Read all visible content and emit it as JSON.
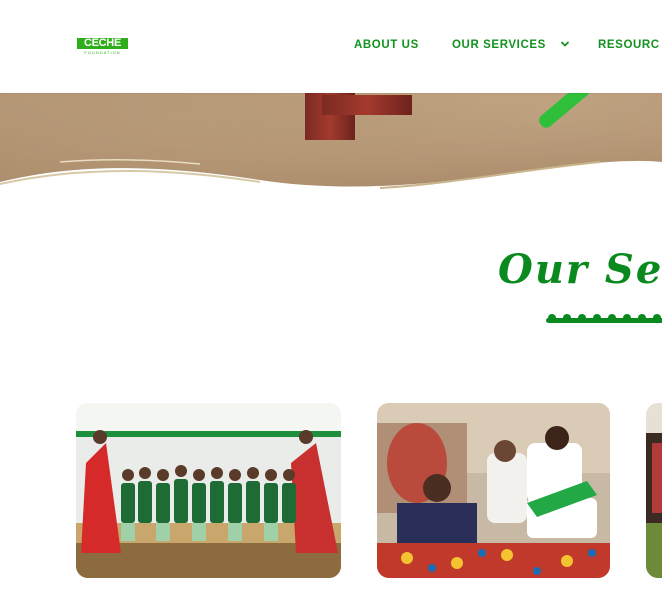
{
  "logo": {
    "name": "CECHE",
    "tagline": "FOUNDATION"
  },
  "nav": {
    "items": [
      {
        "label": "ABOUT US"
      },
      {
        "label": "OUR SERVICES"
      },
      {
        "label": "RESOURC"
      }
    ]
  },
  "section": {
    "title": "Our Ser"
  },
  "colors": {
    "brand_green": "#13921f",
    "title_green": "#0a8a1e",
    "logo_green": "#2fae1b"
  },
  "icons": {
    "services_dropdown": "chevron-down-icon"
  }
}
